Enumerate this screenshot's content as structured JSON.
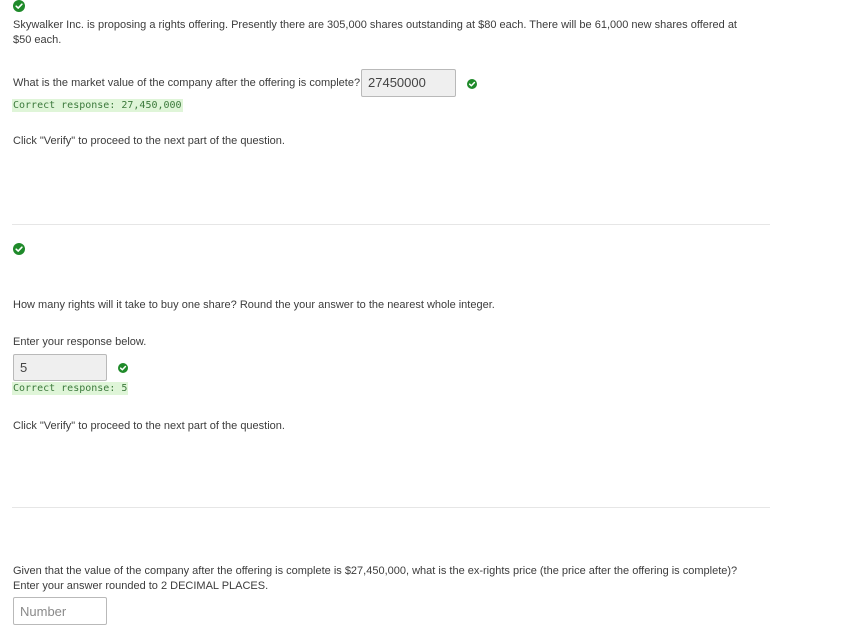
{
  "part1": {
    "problem_text": "Skywalker Inc. is proposing a rights offering. Presently there are 305,000 shares outstanding at $80 each. There will be 61,000 new shares offered at $50 each.",
    "question": "What is the market value of the company after the offering is complete?",
    "answer_value": "27450000",
    "correct_response": "Correct response: 27,450,000",
    "verify_note": "Click \"Verify\" to proceed to the next part of the question."
  },
  "part2": {
    "question": "How many rights will it take to buy one share? Round the your answer to the nearest whole integer.",
    "prompt": "Enter your response below.",
    "answer_value": "5",
    "correct_response": "Correct response: 5",
    "verify_note": "Click \"Verify\" to proceed to the next part of the question."
  },
  "part3": {
    "question": "Given that the value of the company after the offering is complete is $27,450,000, what is the ex-rights price (the price after the offering is complete)? Enter your answer rounded to 2 DECIMAL PLACES.",
    "input_placeholder": "Number"
  },
  "colors": {
    "success_green": "#1f8a2a",
    "correct_bg": "#dff5d8"
  }
}
